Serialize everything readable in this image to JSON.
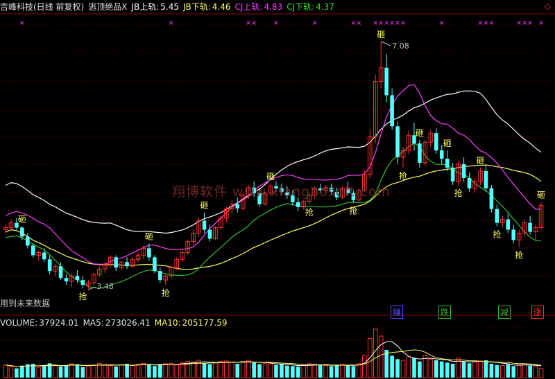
{
  "header": {
    "stock": "吉峰科技(日线 前复权)",
    "indicator": "逃顶绝品X",
    "jb_up_label": "JB上轨:",
    "jb_up_val": "5.45",
    "jb_dn_label": "JB下轨:",
    "jb_dn_val": "4.46",
    "cj_up_label": "CJ上轨:",
    "cj_up_val": "4.83",
    "cj_dn_label": "CJ下轨:",
    "cj_dn_val": "4.37"
  },
  "volume_header": {
    "vol_label": "VOLUME:",
    "vol_val": "37924.01",
    "ma5_label": "MA5:",
    "ma5_val": "273026.41",
    "ma10_label": "MA10:",
    "ma10_val": "205177.59"
  },
  "note": "用到未来数据",
  "watermark": "翔博软件 www.xiangbosoft.com",
  "tags": [
    {
      "text": "赚",
      "color": "#5050ff",
      "x": 563
    },
    {
      "text": "跌",
      "color": "#30c030",
      "x": 632
    },
    {
      "text": "减",
      "color": "#30c030",
      "x": 718
    },
    {
      "text": "涨",
      "color": "#ff3030",
      "x": 766
    }
  ],
  "colors": {
    "up": "#ff3030",
    "down": "#54ffff",
    "jb_up": "#ffffff",
    "jb_dn": "#ffff60",
    "cj_up": "#ff40ff",
    "cj_dn": "#30c030",
    "grid": "#8b0000",
    "axis": "#8b0000"
  },
  "chart_data": {
    "type": "candlestick",
    "y_range": [
      3.3,
      7.3
    ],
    "high_label": "7.08",
    "low_label": "3.48",
    "signal_labels": {
      "top": "砸",
      "bottom": "抢"
    },
    "top_marker": "×",
    "candles": [
      [
        4.35,
        4.42,
        4.3,
        4.38
      ],
      [
        4.38,
        4.5,
        4.33,
        4.45
      ],
      [
        4.45,
        4.52,
        4.35,
        4.38
      ],
      [
        4.38,
        4.4,
        4.2,
        4.25
      ],
      [
        4.25,
        4.3,
        4.08,
        4.12
      ],
      [
        4.12,
        4.15,
        3.95,
        3.98
      ],
      [
        3.98,
        4.05,
        3.9,
        4.02
      ],
      [
        4.02,
        4.08,
        3.88,
        3.92
      ],
      [
        3.92,
        3.98,
        3.7,
        3.75
      ],
      [
        3.75,
        3.85,
        3.68,
        3.82
      ],
      [
        3.82,
        3.88,
        3.62,
        3.65
      ],
      [
        3.65,
        3.7,
        3.55,
        3.6
      ],
      [
        3.6,
        3.72,
        3.52,
        3.68
      ],
      [
        3.68,
        3.76,
        3.58,
        3.62
      ],
      [
        3.62,
        3.68,
        3.5,
        3.55
      ],
      [
        3.55,
        3.62,
        3.48,
        3.58
      ],
      [
        3.58,
        3.72,
        3.55,
        3.7
      ],
      [
        3.7,
        3.82,
        3.66,
        3.78
      ],
      [
        3.78,
        3.88,
        3.72,
        3.85
      ],
      [
        3.85,
        3.98,
        3.8,
        3.95
      ],
      [
        3.95,
        3.98,
        3.75,
        3.8
      ],
      [
        3.8,
        3.9,
        3.76,
        3.88
      ],
      [
        3.88,
        3.95,
        3.78,
        3.82
      ],
      [
        3.82,
        3.95,
        3.8,
        3.92
      ],
      [
        3.92,
        4.02,
        3.88,
        3.98
      ],
      [
        3.98,
        4.12,
        3.92,
        4.08
      ],
      [
        4.08,
        4.15,
        3.9,
        3.95
      ],
      [
        3.95,
        3.98,
        3.72,
        3.75
      ],
      [
        3.75,
        3.8,
        3.58,
        3.62
      ],
      [
        3.62,
        3.7,
        3.55,
        3.68
      ],
      [
        3.68,
        3.82,
        3.64,
        3.8
      ],
      [
        3.8,
        3.95,
        3.76,
        3.92
      ],
      [
        3.92,
        4.05,
        3.88,
        4.02
      ],
      [
        4.02,
        4.2,
        3.98,
        4.18
      ],
      [
        4.18,
        4.35,
        4.12,
        4.3
      ],
      [
        4.3,
        4.52,
        4.25,
        4.48
      ],
      [
        4.48,
        4.6,
        4.3,
        4.35
      ],
      [
        4.35,
        4.42,
        4.18,
        4.22
      ],
      [
        4.22,
        4.4,
        4.2,
        4.38
      ],
      [
        4.38,
        4.55,
        4.35,
        4.52
      ],
      [
        4.52,
        4.68,
        4.46,
        4.65
      ],
      [
        4.65,
        4.78,
        4.58,
        4.72
      ],
      [
        4.72,
        4.82,
        4.6,
        4.66
      ],
      [
        4.66,
        4.88,
        4.62,
        4.85
      ],
      [
        4.85,
        5.0,
        4.8,
        4.96
      ],
      [
        4.96,
        5.05,
        4.82,
        4.88
      ],
      [
        4.88,
        4.95,
        4.68,
        4.72
      ],
      [
        4.72,
        4.9,
        4.7,
        4.88
      ],
      [
        4.88,
        5.02,
        4.84,
        4.98
      ],
      [
        4.98,
        5.05,
        4.9,
        4.95
      ],
      [
        4.95,
        5.02,
        4.86,
        4.9
      ],
      [
        4.9,
        4.98,
        4.8,
        4.85
      ],
      [
        4.85,
        4.92,
        4.7,
        4.75
      ],
      [
        4.75,
        4.82,
        4.62,
        4.68
      ],
      [
        4.68,
        4.78,
        4.64,
        4.76
      ],
      [
        4.76,
        4.88,
        4.72,
        4.85
      ],
      [
        4.85,
        4.98,
        4.8,
        4.95
      ],
      [
        4.95,
        5.02,
        4.88,
        4.92
      ],
      [
        4.92,
        5.0,
        4.85,
        4.96
      ],
      [
        4.96,
        5.02,
        4.86,
        4.9
      ],
      [
        4.9,
        4.96,
        4.78,
        4.82
      ],
      [
        4.82,
        4.98,
        4.8,
        4.95
      ],
      [
        4.95,
        5.05,
        4.85,
        4.88
      ],
      [
        4.88,
        4.92,
        4.74,
        4.78
      ],
      [
        4.78,
        4.95,
        4.76,
        4.92
      ],
      [
        4.92,
        5.2,
        4.9,
        5.15
      ],
      [
        5.15,
        5.8,
        5.1,
        5.7
      ],
      [
        5.7,
        6.6,
        5.6,
        6.5
      ],
      [
        6.5,
        7.08,
        6.4,
        6.7
      ],
      [
        6.7,
        6.9,
        6.2,
        6.3
      ],
      [
        6.3,
        6.4,
        5.8,
        5.85
      ],
      [
        5.85,
        5.92,
        5.3,
        5.4
      ],
      [
        5.4,
        5.55,
        5.25,
        5.5
      ],
      [
        5.5,
        5.78,
        5.45,
        5.72
      ],
      [
        5.72,
        5.9,
        5.5,
        5.6
      ],
      [
        5.6,
        5.65,
        5.25,
        5.32
      ],
      [
        5.32,
        5.65,
        5.28,
        5.62
      ],
      [
        5.62,
        5.8,
        5.55,
        5.75
      ],
      [
        5.75,
        5.82,
        5.45,
        5.5
      ],
      [
        5.5,
        5.58,
        5.3,
        5.38
      ],
      [
        5.38,
        5.5,
        5.2,
        5.25
      ],
      [
        5.25,
        5.32,
        5.0,
        5.05
      ],
      [
        5.05,
        5.35,
        5.0,
        5.3
      ],
      [
        5.3,
        5.4,
        5.05,
        5.1
      ],
      [
        5.1,
        5.18,
        4.9,
        4.95
      ],
      [
        4.95,
        5.1,
        4.88,
        5.05
      ],
      [
        5.05,
        5.25,
        5.0,
        5.2
      ],
      [
        5.2,
        5.3,
        4.9,
        4.95
      ],
      [
        4.95,
        5.0,
        4.6,
        4.65
      ],
      [
        4.65,
        4.72,
        4.4,
        4.45
      ],
      [
        4.45,
        4.55,
        4.38,
        4.5
      ],
      [
        4.5,
        4.58,
        4.3,
        4.35
      ],
      [
        4.35,
        4.42,
        4.15,
        4.2
      ],
      [
        4.2,
        4.35,
        4.1,
        4.3
      ],
      [
        4.3,
        4.5,
        4.25,
        4.45
      ],
      [
        4.45,
        4.55,
        4.28,
        4.32
      ],
      [
        4.32,
        4.42,
        4.2,
        4.38
      ],
      [
        4.38,
        4.75,
        4.35,
        4.7
      ]
    ],
    "signals": [
      {
        "i": 3,
        "type": "top"
      },
      {
        "i": 14,
        "type": "bottom"
      },
      {
        "i": 26,
        "type": "top"
      },
      {
        "i": 29,
        "type": "bottom"
      },
      {
        "i": 36,
        "type": "top"
      },
      {
        "i": 48,
        "type": "top"
      },
      {
        "i": 55,
        "type": "bottom"
      },
      {
        "i": 63,
        "type": "bottom"
      },
      {
        "i": 68,
        "type": "top"
      },
      {
        "i": 72,
        "type": "bottom"
      },
      {
        "i": 75,
        "type": "top"
      },
      {
        "i": 80,
        "type": "top"
      },
      {
        "i": 82,
        "type": "bottom"
      },
      {
        "i": 86,
        "type": "top"
      },
      {
        "i": 89,
        "type": "bottom"
      },
      {
        "i": 93,
        "type": "bottom"
      },
      {
        "i": 97,
        "type": "top"
      }
    ],
    "top_markers": [
      3,
      30,
      44,
      45,
      49,
      56,
      63,
      64,
      67,
      68,
      69,
      70,
      71,
      72,
      79,
      86,
      87,
      88,
      93,
      94,
      95,
      97
    ],
    "volume": [
      55,
      48,
      40,
      52,
      58,
      60,
      45,
      50,
      62,
      55,
      48,
      52,
      60,
      58,
      45,
      50,
      55,
      62,
      58,
      52,
      48,
      55,
      60,
      52,
      58,
      62,
      55,
      50,
      58,
      60,
      62,
      55,
      65,
      70,
      68,
      75,
      62,
      58,
      65,
      70,
      72,
      68,
      60,
      70,
      75,
      65,
      58,
      62,
      60,
      55,
      58,
      52,
      50,
      48,
      55,
      60,
      58,
      55,
      52,
      50,
      55,
      58,
      52,
      50,
      60,
      95,
      170,
      210,
      180,
      120,
      95,
      80,
      75,
      90,
      85,
      70,
      95,
      80,
      75,
      70,
      65,
      60,
      85,
      70,
      62,
      68,
      72,
      75,
      60,
      55,
      52,
      58,
      50,
      55,
      60,
      52,
      48,
      40
    ]
  }
}
